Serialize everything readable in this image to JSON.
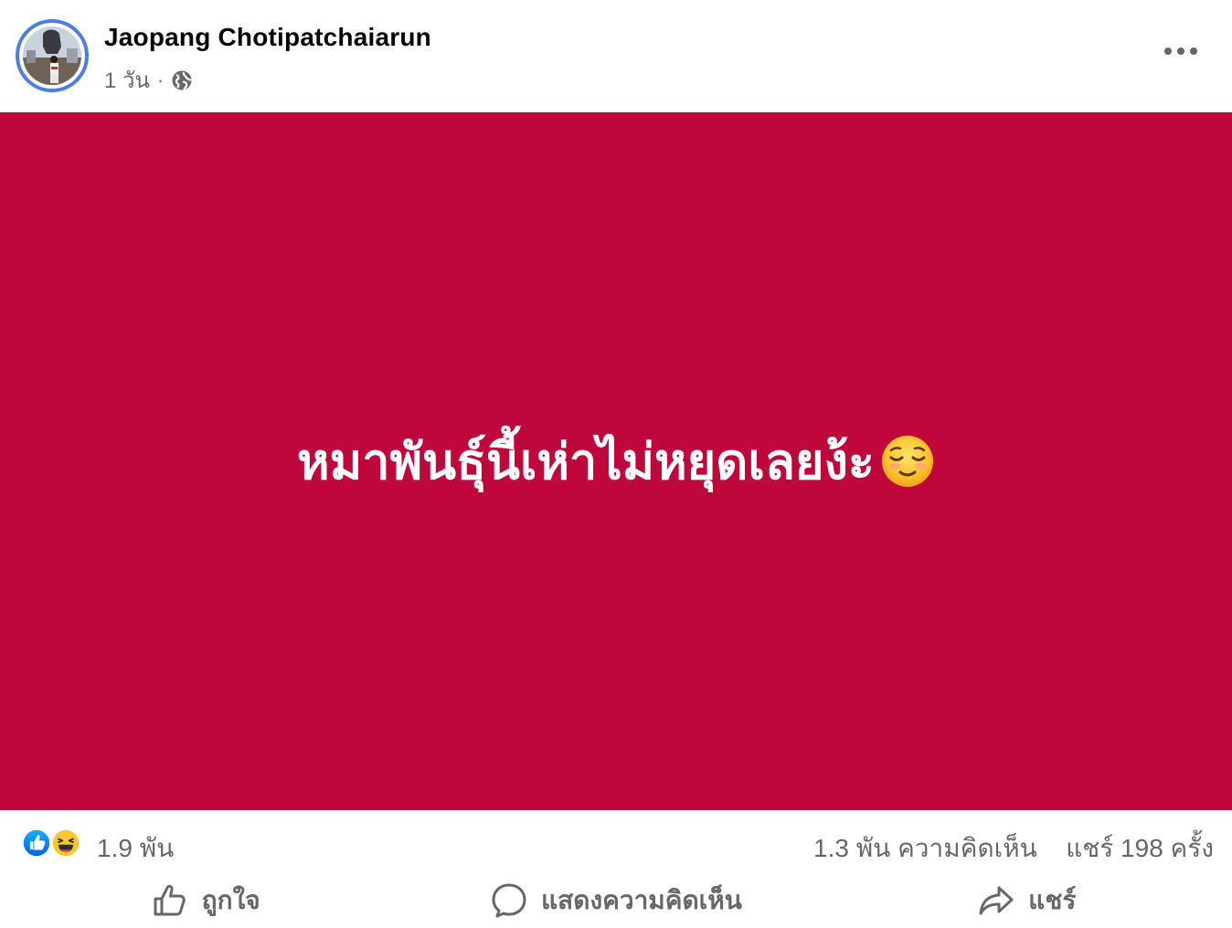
{
  "post": {
    "author": "Jaopang Chotipatchaiarun",
    "time": "1 วัน",
    "separator": "·",
    "privacy_icon": "globe-icon",
    "more_icon": "more-options-icon",
    "body_text": "หมาพันธุ์นี้เห่าไม่หยุดเลยง้ะ",
    "body_emoji": "relieved-face-emoji",
    "background_color": "#c0073b"
  },
  "stats": {
    "reactions": [
      "like-reaction-icon",
      "haha-reaction-icon"
    ],
    "reaction_count": "1.9 พัน",
    "comment_count": "1.3 พัน ความคิดเห็น",
    "share_count": "แชร์ 198 ครั้ง"
  },
  "actions": {
    "like_label": "ถูกใจ",
    "comment_label": "แสดงความคิดเห็น",
    "share_label": "แชร์"
  }
}
